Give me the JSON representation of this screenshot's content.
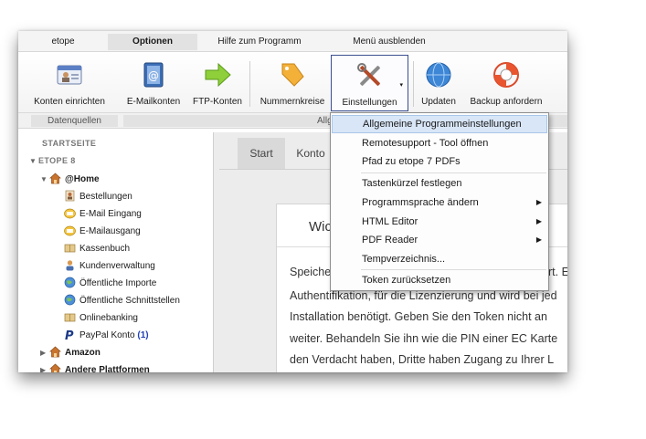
{
  "tabs": [
    {
      "label": "etope"
    },
    {
      "label": "Optionen"
    },
    {
      "label": "Hilfe zum Programm"
    },
    {
      "label": "Menü ausblenden"
    }
  ],
  "ribbon": {
    "buttons": [
      {
        "label": "Konten einrichten",
        "icon": "id-card-icon"
      },
      {
        "label": "E-Mailkonten",
        "icon": "address-book-icon"
      },
      {
        "label": "FTP-Konten",
        "icon": "green-arrow-icon"
      },
      {
        "label": "Nummernkreise",
        "icon": "tag-icon"
      },
      {
        "label": "Einstellungen",
        "icon": "tools-icon"
      },
      {
        "label": "Updaten",
        "icon": "globe-icon"
      },
      {
        "label": "Backup anfordern",
        "icon": "lifebuoy-icon"
      }
    ],
    "groups": [
      {
        "label": "Datenquellen"
      },
      {
        "label": "Allg"
      }
    ]
  },
  "sidebar": {
    "heading1": "STARTSEITE",
    "heading2": "ETOPE 8",
    "home": "@Home",
    "items": [
      {
        "label": "Bestellungen",
        "icon": "document-person-icon"
      },
      {
        "label": "E-Mail Eingang",
        "icon": "mail-inbox-icon"
      },
      {
        "label": "E-Mailausgang",
        "icon": "mail-outbox-icon"
      },
      {
        "label": "Kassenbuch",
        "icon": "book-icon"
      },
      {
        "label": "Kundenverwaltung",
        "icon": "person-icon"
      },
      {
        "label": "Öffentliche Importe",
        "icon": "globe-icon"
      },
      {
        "label": "Öffentliche Schnittstellen",
        "icon": "globe-icon"
      },
      {
        "label": "Onlinebanking",
        "icon": "book-icon"
      },
      {
        "label": "PayPal Konto",
        "icon": "paypal-icon",
        "badge": "(1)"
      }
    ],
    "amazon": "Amazon",
    "andere": "Andere Plattformen"
  },
  "main": {
    "tabs": [
      {
        "label": "Start"
      },
      {
        "label": "Konto"
      }
    ],
    "card_title": "Wic",
    "lines": [
      "Speiche",
      "Authentifikation, für die Lizenzierung und wird bei jed",
      "Installation benötigt. Geben Sie den Token nicht an",
      "weiter. Behandeln Sie ihn wie die PIN einer EC Karte",
      "den Verdacht haben, Dritte haben Zugang zu Ihrer L"
    ],
    "tail": "rt. E"
  },
  "menu": {
    "items": [
      {
        "label": "Allgemeine Programmeinstellungen",
        "accel": "A",
        "highlighted": true
      },
      {
        "label": "Remotesupport - Tool öffnen",
        "accel": "R"
      },
      {
        "label": "Pfad zu etope 7 PDFs",
        "accel": "P"
      },
      {
        "label": "Tastenkürzel festlegen",
        "accel": "T"
      },
      {
        "label": "Programmsprache ändern",
        "submenu": true
      },
      {
        "label": "HTML Editor",
        "accel": "H",
        "submenu": true
      },
      {
        "label": "PDF Reader",
        "submenu": true
      },
      {
        "label": "Tempverzeichnis...",
        "accel": "T"
      },
      {
        "label": "Token zurücksetzen"
      }
    ]
  }
}
